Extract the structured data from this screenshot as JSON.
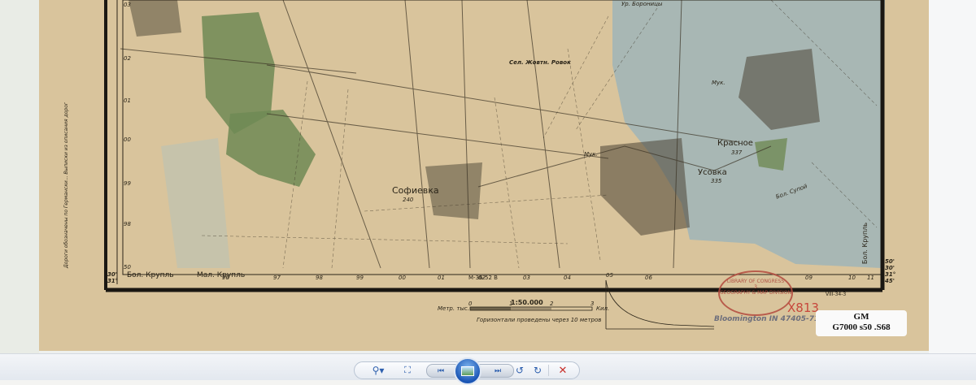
{
  "map": {
    "places": {
      "sofievka": "Софиевка",
      "sofievka_height": "240",
      "krasnoe": "Красное",
      "krasnoe_height": "337",
      "usovka": "Усовка",
      "usovka_height": "335",
      "bol_krupl": "Бол. Крупль",
      "mal_krupl": "Мал. Крупль",
      "selo": "Сел. Жовтн. Ровок",
      "urochishche": "Ур. Бороницы",
      "muk1": "Мук.",
      "muk2": "Мук.",
      "ruchey": "Бол. Супой",
      "krupl_side": "Бол. Крупль"
    },
    "grid_bottom": [
      "96",
      "97",
      "98",
      "99",
      "00",
      "01",
      "02",
      "03",
      "04",
      "05",
      "06",
      "09",
      "10",
      "11"
    ],
    "grid_left": [
      "03",
      "02",
      "01",
      "00",
      "99",
      "98",
      "50"
    ],
    "corner_left": [
      "30'",
      "31°",
      "30'"
    ],
    "corner_right": [
      "50'",
      "30'",
      "31°",
      "45'"
    ],
    "sheet": "М-36-52 В",
    "scale_ratio": "1:50.000",
    "scale_units_left": "Метр. тыс.",
    "scale_units_right": "Кил.",
    "scale_ticks": [
      "0",
      "1",
      "2",
      "3"
    ],
    "contour_note": "Горизонтали проведены через 10 метров",
    "side_note": "Дороги обозначены по Германски... Выписки из описания дорог",
    "adjacent_sheet": "VIII-34-3",
    "stamp": {
      "line1": "LIBRARY OF CONGRESS",
      "line2": "3",
      "line3": "GEOGRAPHY & MAP DIVISION",
      "address": "Bloomington IN 47405-7100",
      "handwritten": "X813"
    },
    "call_number": {
      "line1": "GM",
      "line2": "G7000 s50 .S68"
    }
  },
  "toolbar": {
    "zoom": "zoom-in",
    "fit": "actual-size",
    "prev": "previous",
    "slideshow": "slideshow",
    "next": "next",
    "rotate_ccw": "rotate-counterclockwise",
    "rotate_cw": "rotate-clockwise",
    "delete": "delete"
  },
  "colors": {
    "paper": "#d9c49c",
    "water": "#a8b7b4",
    "forest": "#6f8a55",
    "ink": "#2a2418",
    "delete": "#c8302b",
    "toolbar_icon": "#2d5fae"
  }
}
